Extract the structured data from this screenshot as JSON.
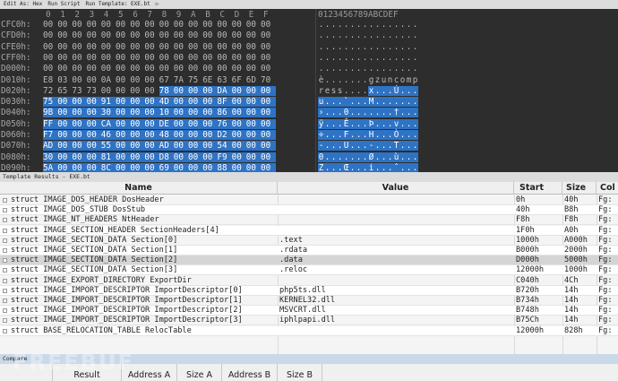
{
  "toolbar": {
    "items": [
      "Edit As: Hex",
      "Run Script",
      "Run Template: EXE.bt",
      "▷"
    ]
  },
  "hex": {
    "column_header": [
      "0",
      "1",
      "2",
      "3",
      "4",
      "5",
      "6",
      "7",
      "8",
      "9",
      "A",
      "B",
      "C",
      "D",
      "E",
      "F"
    ],
    "ascii_header": "0123456789ABCDEF",
    "rows": [
      {
        "addr": "CFC0h:",
        "bytes": [
          "00",
          "00",
          "00",
          "00",
          "00",
          "00",
          "00",
          "00",
          "00",
          "00",
          "00",
          "00",
          "00",
          "00",
          "00",
          "00"
        ],
        "ascii": "................",
        "sel_from": -1
      },
      {
        "addr": "CFD0h:",
        "bytes": [
          "00",
          "00",
          "00",
          "00",
          "00",
          "00",
          "00",
          "00",
          "00",
          "00",
          "00",
          "00",
          "00",
          "00",
          "00",
          "00"
        ],
        "ascii": "................",
        "sel_from": -1
      },
      {
        "addr": "CFE0h:",
        "bytes": [
          "00",
          "00",
          "00",
          "00",
          "00",
          "00",
          "00",
          "00",
          "00",
          "00",
          "00",
          "00",
          "00",
          "00",
          "00",
          "00"
        ],
        "ascii": "................",
        "sel_from": -1
      },
      {
        "addr": "CFF0h:",
        "bytes": [
          "00",
          "00",
          "00",
          "00",
          "00",
          "00",
          "00",
          "00",
          "00",
          "00",
          "00",
          "00",
          "00",
          "00",
          "00",
          "00"
        ],
        "ascii": "................",
        "sel_from": -1
      },
      {
        "addr": "D000h:",
        "bytes": [
          "00",
          "00",
          "00",
          "00",
          "00",
          "00",
          "00",
          "00",
          "00",
          "00",
          "00",
          "00",
          "00",
          "00",
          "00",
          "00"
        ],
        "ascii": "................",
        "sel_from": -1
      },
      {
        "addr": "D010h:",
        "bytes": [
          "E8",
          "03",
          "00",
          "00",
          "0A",
          "00",
          "00",
          "00",
          "67",
          "7A",
          "75",
          "6E",
          "63",
          "6F",
          "6D",
          "70"
        ],
        "ascii": "è.......gzuncomp",
        "sel_from": -1
      },
      {
        "addr": "D020h:",
        "bytes": [
          "72",
          "65",
          "73",
          "73",
          "00",
          "00",
          "00",
          "00",
          "78",
          "00",
          "00",
          "00",
          "DA",
          "00",
          "00",
          "00"
        ],
        "ascii": "ress....x...Ú...",
        "sel_from": 8
      },
      {
        "addr": "D030h:",
        "bytes": [
          "75",
          "00",
          "00",
          "00",
          "91",
          "00",
          "00",
          "00",
          "4D",
          "00",
          "00",
          "00",
          "8F",
          "00",
          "00",
          "00"
        ],
        "ascii": "u...`...M.......",
        "sel_from": 0
      },
      {
        "addr": "D040h:",
        "bytes": [
          "9B",
          "00",
          "00",
          "00",
          "30",
          "00",
          "00",
          "00",
          "10",
          "00",
          "00",
          "00",
          "86",
          "00",
          "00",
          "00"
        ],
        "ascii": "›...0.......†...",
        "sel_from": 0
      },
      {
        "addr": "D050h:",
        "bytes": [
          "FF",
          "00",
          "00",
          "00",
          "CA",
          "00",
          "00",
          "00",
          "DE",
          "00",
          "00",
          "00",
          "76",
          "00",
          "00",
          "00"
        ],
        "ascii": "ÿ...Ê...Þ...v...",
        "sel_from": 0
      },
      {
        "addr": "D060h:",
        "bytes": [
          "F7",
          "00",
          "00",
          "00",
          "46",
          "00",
          "00",
          "00",
          "48",
          "00",
          "00",
          "00",
          "D2",
          "00",
          "00",
          "00"
        ],
        "ascii": "÷...F...H...Ò...",
        "sel_from": 0
      },
      {
        "addr": "D070h:",
        "bytes": [
          "AD",
          "00",
          "00",
          "00",
          "55",
          "00",
          "00",
          "00",
          "AD",
          "00",
          "00",
          "00",
          "54",
          "00",
          "00",
          "00"
        ],
        "ascii": "-...U...-...T...",
        "sel_from": 0
      },
      {
        "addr": "D080h:",
        "bytes": [
          "30",
          "00",
          "00",
          "00",
          "81",
          "00",
          "00",
          "00",
          "D8",
          "00",
          "00",
          "00",
          "F9",
          "00",
          "00",
          "00"
        ],
        "ascii": "0.......Ø...ù...",
        "sel_from": 0
      },
      {
        "addr": "D090h:",
        "bytes": [
          "5A",
          "00",
          "00",
          "00",
          "8C",
          "00",
          "00",
          "00",
          "69",
          "00",
          "00",
          "00",
          "88",
          "00",
          "00",
          "00"
        ],
        "ascii": "Z...Œ...i...ˆ...",
        "sel_from": 0
      }
    ]
  },
  "template_results": {
    "title": "Template Results - EXE.bt",
    "columns": [
      "Name",
      "Value",
      "Start",
      "Size",
      "Col"
    ],
    "rows": [
      {
        "name": "struct IMAGE_DOS_HEADER DosHeader",
        "value": "",
        "start": "0h",
        "size": "40h",
        "color": "Fg:"
      },
      {
        "name": "struct IMAGE_DOS_STUB DosStub",
        "value": "",
        "start": "40h",
        "size": "B8h",
        "color": "Fg:"
      },
      {
        "name": "struct IMAGE_NT_HEADERS NtHeader",
        "value": "",
        "start": "F8h",
        "size": "F8h",
        "color": "Fg:"
      },
      {
        "name": "struct IMAGE_SECTION_HEADER SectionHeaders[4]",
        "value": "",
        "start": "1F0h",
        "size": "A0h",
        "color": "Fg:"
      },
      {
        "name": "struct IMAGE_SECTION_DATA Section[0]",
        "value": ".text",
        "start": "1000h",
        "size": "A000h",
        "color": "Fg:"
      },
      {
        "name": "struct IMAGE_SECTION_DATA Section[1]",
        "value": ".rdata",
        "start": "B000h",
        "size": "2000h",
        "color": "Fg:"
      },
      {
        "name": "struct IMAGE_SECTION_DATA Section[2]",
        "value": ".data",
        "start": "D000h",
        "size": "5000h",
        "color": "Fg:"
      },
      {
        "name": "struct IMAGE_SECTION_DATA Section[3]",
        "value": ".reloc",
        "start": "12000h",
        "size": "1000h",
        "color": "Fg:"
      },
      {
        "name": "struct IMAGE_EXPORT_DIRECTORY ExportDir",
        "value": "",
        "start": "C040h",
        "size": "4Ch",
        "color": "Fg:"
      },
      {
        "name": "struct IMAGE_IMPORT_DESCRIPTOR ImportDescriptor[0]",
        "value": "php5ts.dll",
        "start": "B720h",
        "size": "14h",
        "color": "Fg:"
      },
      {
        "name": "struct IMAGE_IMPORT_DESCRIPTOR ImportDescriptor[1]",
        "value": "KERNEL32.dll",
        "start": "B734h",
        "size": "14h",
        "color": "Fg:"
      },
      {
        "name": "struct IMAGE_IMPORT_DESCRIPTOR ImportDescriptor[2]",
        "value": "MSVCRT.dll",
        "start": "B748h",
        "size": "14h",
        "color": "Fg:"
      },
      {
        "name": "struct IMAGE_IMPORT_DESCRIPTOR ImportDescriptor[3]",
        "value": "iphlpapi.dll",
        "start": "B75Ch",
        "size": "14h",
        "color": "Fg:"
      },
      {
        "name": "struct BASE_RELOCATION_TABLE RelocTable",
        "value": "",
        "start": "12000h",
        "size": "828h",
        "color": "Fg:"
      }
    ],
    "highlighted_row": 6
  },
  "compare": {
    "title": "Compare",
    "columns": [
      "Result",
      "Address A",
      "Size A",
      "Address B",
      "Size B"
    ]
  },
  "watermark": "FREEBUF",
  "colors": {
    "selection": "#2f73c4",
    "hex_bg": "#2d2d2d",
    "table_bg": "#f4f4f4"
  }
}
